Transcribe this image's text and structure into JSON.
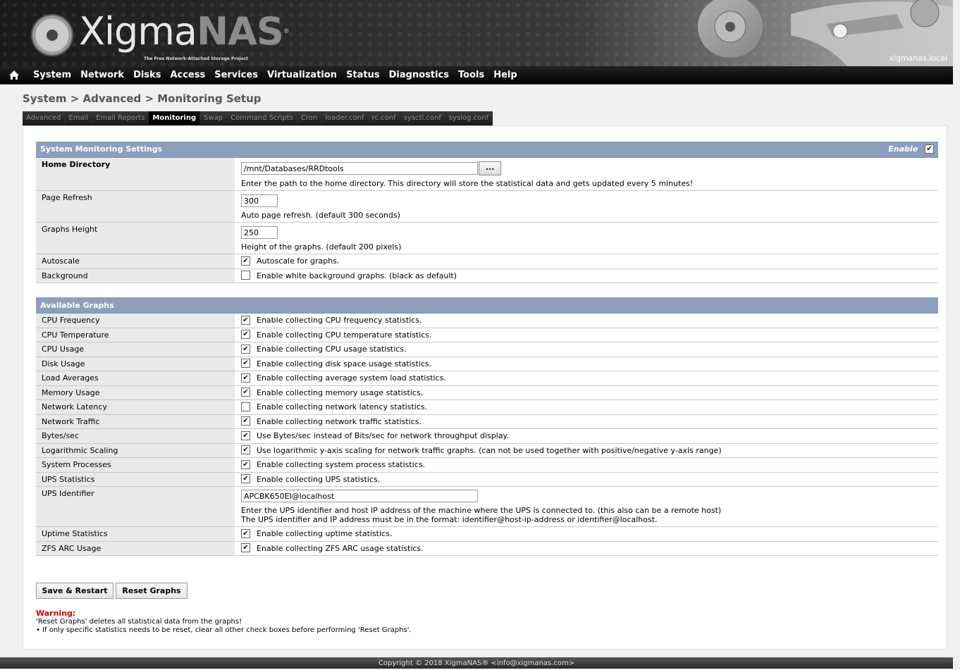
{
  "header": {
    "logo_part1": "Xigma",
    "logo_part2": "NAS",
    "logo_registered": "®",
    "tagline": "The Free Network-Attached Storage Project",
    "hostname": "xigmanas.local"
  },
  "nav": {
    "items": [
      "System",
      "Network",
      "Disks",
      "Access",
      "Services",
      "Virtualization",
      "Status",
      "Diagnostics",
      "Tools",
      "Help"
    ]
  },
  "page": {
    "title": "System > Advanced > Monitoring Setup"
  },
  "tabs": [
    {
      "label": "Advanced",
      "active": false
    },
    {
      "label": "Email",
      "active": false
    },
    {
      "label": "Email Reports",
      "active": false
    },
    {
      "label": "Monitoring",
      "active": true
    },
    {
      "label": "Swap",
      "active": false
    },
    {
      "label": "Command Scripts",
      "active": false
    },
    {
      "label": "Cron",
      "active": false
    },
    {
      "label": "loader.conf",
      "active": false
    },
    {
      "label": "rc.conf",
      "active": false
    },
    {
      "label": "sysctl.conf",
      "active": false
    },
    {
      "label": "syslog.conf",
      "active": false
    }
  ],
  "monitoring": {
    "section_title": "System Monitoring Settings",
    "enable_label": "Enable",
    "enable_checked": true,
    "home_directory": {
      "label": "Home Directory",
      "value": "/mnt/Databases/RRDtools",
      "browse": "...",
      "description": "Enter the path to the home directory. This directory will store the statistical data and gets updated every 5 minutes!"
    },
    "page_refresh": {
      "label": "Page Refresh",
      "value": "300",
      "description": "Auto page refresh. (default 300 seconds)"
    },
    "graphs_height": {
      "label": "Graphs Height",
      "value": "250",
      "description": "Height of the graphs. (default 200 pixels)"
    },
    "autoscale": {
      "label": "Autoscale",
      "checked": true,
      "text": "Autoscale for graphs."
    },
    "background": {
      "label": "Background",
      "checked": false,
      "text": "Enable white background graphs. (black as default)"
    }
  },
  "graphs": {
    "section_title": "Available Graphs",
    "cpu_frequency": {
      "label": "CPU Frequency",
      "checked": true,
      "text": "Enable collecting CPU frequency statistics."
    },
    "cpu_temperature": {
      "label": "CPU Temperature",
      "checked": true,
      "text": "Enable collecting CPU temperature statistics."
    },
    "cpu_usage": {
      "label": "CPU Usage",
      "checked": true,
      "text": "Enable collecting CPU usage statistics."
    },
    "disk_usage": {
      "label": "Disk Usage",
      "checked": true,
      "text": "Enable collecting disk space usage statistics."
    },
    "load_averages": {
      "label": "Load Averages",
      "checked": true,
      "text": "Enable collecting average system load statistics."
    },
    "memory_usage": {
      "label": "Memory Usage",
      "checked": true,
      "text": "Enable collecting memory usage statistics."
    },
    "network_latency": {
      "label": "Network Latency",
      "checked": false,
      "text": "Enable collecting network latency statistics."
    },
    "network_traffic": {
      "label": "Network Traffic",
      "checked": true,
      "text": "Enable collecting network traffic statistics."
    },
    "bytes_sec": {
      "label": "Bytes/sec",
      "checked": true,
      "text": "Use Bytes/sec instead of Bits/sec for network throughput display."
    },
    "log_scaling": {
      "label": "Logarithmic Scaling",
      "checked": true,
      "text": "Use logarithmic y-axis scaling for network traffic graphs. (can not be used together with positive/negative y-axis range)"
    },
    "system_processes": {
      "label": "System Processes",
      "checked": true,
      "text": "Enable collecting system process statistics."
    },
    "ups_statistics": {
      "label": "UPS Statistics",
      "checked": true,
      "text": "Enable collecting UPS statistics."
    },
    "ups_identifier": {
      "label": "UPS Identifier",
      "value": "APCBK650EI@localhost",
      "description1": "Enter the UPS identifier and host IP address of the machine where the UPS is connected to. (this also can be a remote host)",
      "description2": "The UPS identifier and IP address must be in the format: identifier@host-ip-address or identifier@localhost."
    },
    "uptime_statistics": {
      "label": "Uptime Statistics",
      "checked": true,
      "text": "Enable collecting uptime statistics."
    },
    "zfs_arc_usage": {
      "label": "ZFS ARC Usage",
      "checked": true,
      "text": "Enable collecting ZFS ARC usage statistics."
    }
  },
  "buttons": {
    "save": "Save & Restart",
    "reset": "Reset Graphs"
  },
  "warning": {
    "title": "Warning:",
    "line1": "'Reset Graphs' deletes all statistical data from the graphs!",
    "line2": "•  If only specific statistics needs to be reset, clear all other check boxes before performing 'Reset Graphs'."
  },
  "footer": {
    "text": "Copyright © 2018 XigmaNAS® <info@xigmanas.com>"
  },
  "colors": {
    "section_header": "#8ca0bd",
    "warning": "#cc0000",
    "navbar": "#000000"
  }
}
